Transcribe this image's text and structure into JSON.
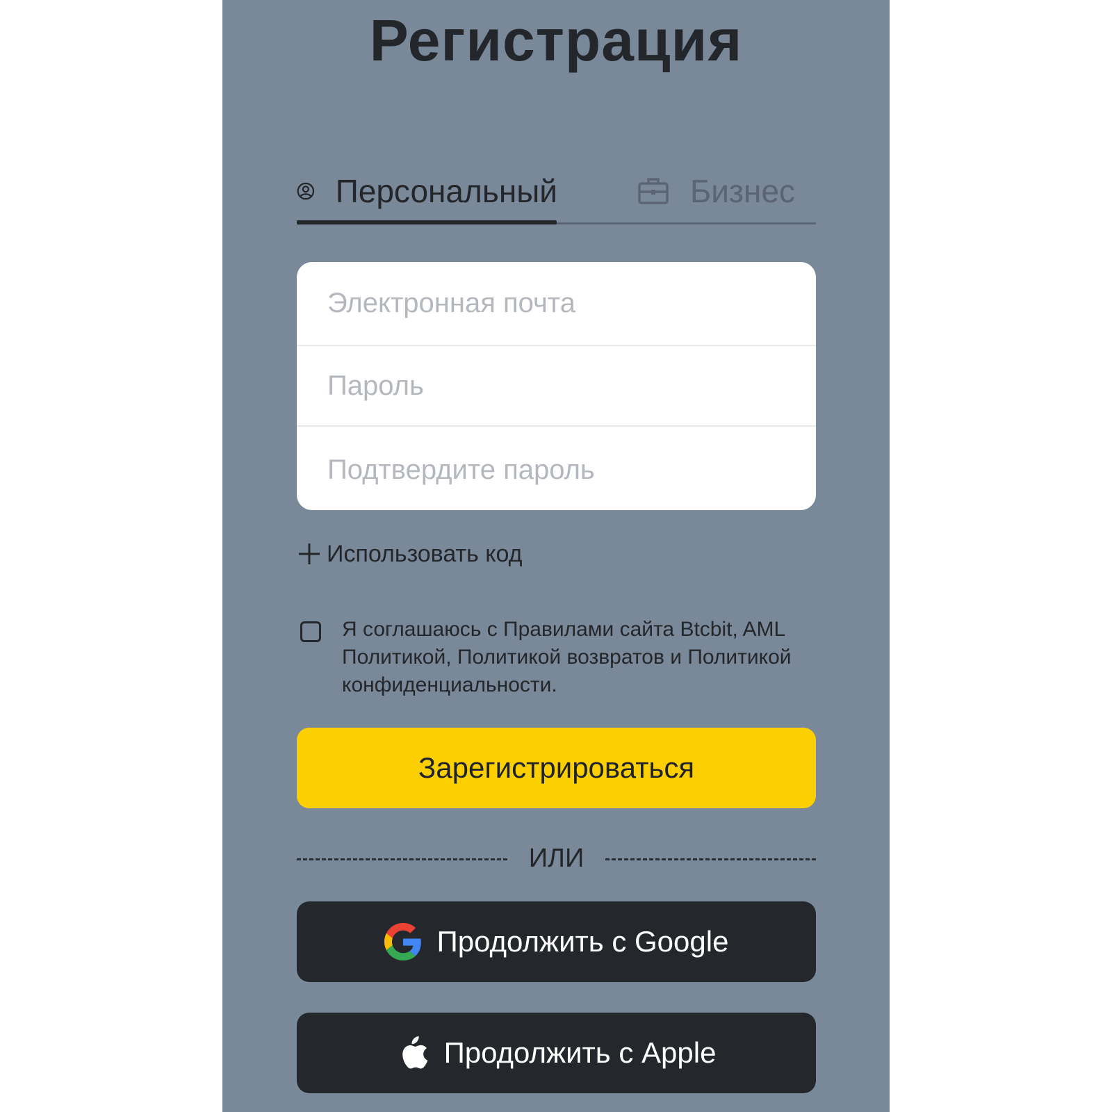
{
  "page": {
    "title": "Регистрация"
  },
  "tabs": {
    "personal_label": "Персональный",
    "personal_icon": "user-circle-icon",
    "business_label": "Бизнес",
    "business_icon": "briefcase-icon",
    "active": "personal"
  },
  "form": {
    "email_placeholder": "Электронная почта",
    "email_value": "",
    "password_placeholder": "Пароль",
    "password_value": "",
    "confirm_placeholder": "Подтвердите пароль",
    "confirm_value": ""
  },
  "use_code": {
    "label": "Использовать код",
    "icon": "plus-icon"
  },
  "agreement": {
    "checked": false,
    "text": "Я соглашаюсь с Правилами сайта Btcbit, AML Политикой, Политикой возвратов и Политикой конфиденциальности."
  },
  "buttons": {
    "register_label": "Зарегистрироваться",
    "divider_label": "ИЛИ",
    "google_label": "Продолжить с Google",
    "google_icon": "google-logo-icon",
    "apple_label": "Продолжить с Apple",
    "apple_icon": "apple-logo-icon"
  },
  "colors": {
    "panel_bg": "#7a8999",
    "primary_button": "#fcd000",
    "dark_button": "#24282c",
    "text_dark": "#23272b"
  }
}
